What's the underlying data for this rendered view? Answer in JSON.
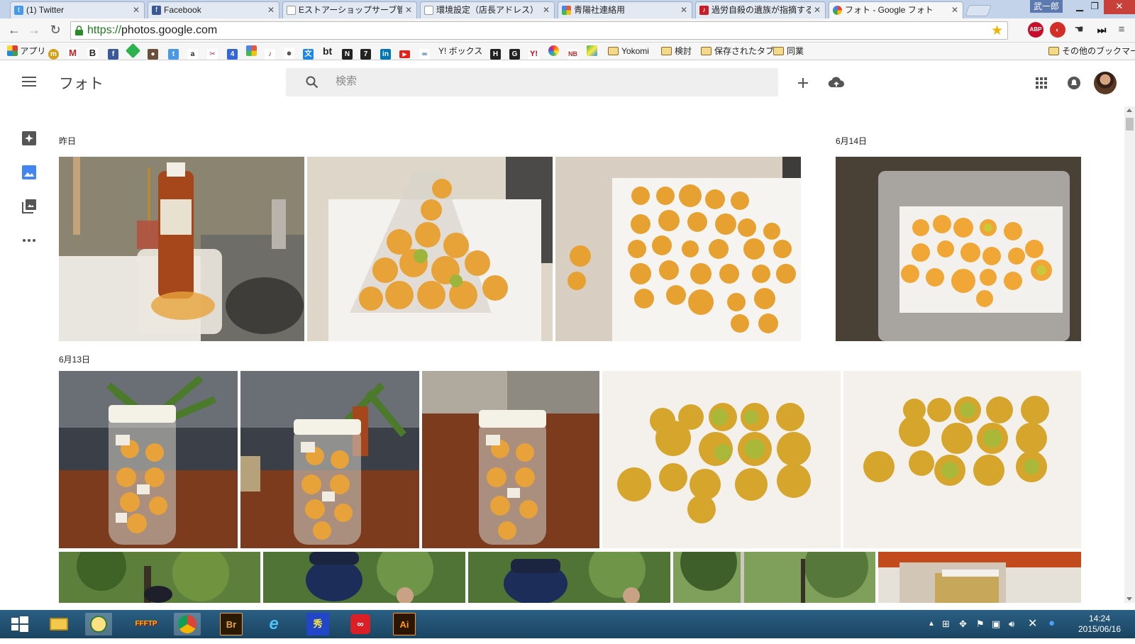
{
  "browser": {
    "tabs": [
      {
        "title": "(1) Twitter",
        "favicon": "twitter-icon",
        "color": "#4a99e9"
      },
      {
        "title": "Facebook",
        "favicon": "facebook-icon",
        "color": "#3b5998"
      },
      {
        "title": "Eストアーショップサーブ管理画",
        "favicon": "page-icon",
        "color": "#ffffff"
      },
      {
        "title": "環境設定（店長アドレス）",
        "favicon": "page-icon",
        "color": "#ffffff"
      },
      {
        "title": "青陽社連絡用",
        "favicon": "pinwheel-icon",
        "color": "#e25a3a"
      },
      {
        "title": "過労自殺の遺族が指摘する「",
        "favicon": "news-icon",
        "color": "#c81d25"
      },
      {
        "title": "フォト - Google フォト",
        "favicon": "google-photos-icon",
        "color": "#fbbc05"
      }
    ],
    "active_tab_index": 6,
    "window_user": "武一郎",
    "url_scheme": "https://",
    "url_host": "photos.google.com",
    "bookmarks": [
      {
        "label": "アプリ",
        "icon": "apps-grid-icon",
        "color": "#d84315"
      },
      {
        "label": "",
        "icon": "mixi-icon",
        "color": "#d4a017"
      },
      {
        "label": "",
        "icon": "gmail-icon",
        "color": "#c5221f"
      },
      {
        "label": "",
        "icon": "blogger-b-icon",
        "color": "#222222"
      },
      {
        "label": "",
        "icon": "facebook-icon",
        "color": "#3b5998"
      },
      {
        "label": "",
        "icon": "feedly-icon",
        "color": "#2bb24c"
      },
      {
        "label": "",
        "icon": "person-icon",
        "color": "#6b4f3a"
      },
      {
        "label": "",
        "icon": "twitter-icon",
        "color": "#4a99e9"
      },
      {
        "label": "",
        "icon": "amazon-icon",
        "color": "#222222"
      },
      {
        "label": "",
        "icon": "tool-icon",
        "color": "#c2185b"
      },
      {
        "label": "",
        "icon": "calendar-icon",
        "color": "#3367d6"
      },
      {
        "label": "",
        "icon": "pinwheel-icon",
        "color": "#e25a3a"
      },
      {
        "label": "",
        "icon": "news-icon",
        "color": "#c81d25"
      },
      {
        "label": "",
        "icon": "apple-icon",
        "color": "#555555"
      },
      {
        "label": "",
        "icon": "translate-icon",
        "color": "#1e88e5"
      },
      {
        "label": "bt",
        "icon": "",
        "color": "#222222"
      },
      {
        "label": "",
        "icon": "notion-icon",
        "color": "#222222"
      },
      {
        "label": "",
        "icon": "seven-icon",
        "color": "#222222"
      },
      {
        "label": "",
        "icon": "linkedin-icon",
        "color": "#0077b5"
      },
      {
        "label": "",
        "icon": "youtube-icon",
        "color": "#e62117"
      },
      {
        "label": "",
        "icon": "ribbon-icon",
        "color": "#1565c0"
      },
      {
        "label": "Y! ボックス",
        "icon": "",
        "color": "#d6001c"
      },
      {
        "label": "",
        "icon": "hatena-icon",
        "color": "#222222"
      },
      {
        "label": "",
        "icon": "g-icon",
        "color": "#222222"
      },
      {
        "label": "",
        "icon": "yahoo-icon",
        "color": "#d6001c"
      },
      {
        "label": "",
        "icon": "colorful-icon",
        "color": "#ff9800"
      },
      {
        "label": "",
        "icon": "nb-icon",
        "color": "#c62828"
      },
      {
        "label": "",
        "icon": "maps-icon",
        "color": "#4caf50"
      },
      {
        "label": "Yokomi",
        "icon": "folder-icon",
        "color": "#f4d98a"
      },
      {
        "label": "検討",
        "icon": "folder-icon",
        "color": "#f4d98a"
      },
      {
        "label": "保存されたタブ",
        "icon": "folder-icon",
        "color": "#f4d98a"
      },
      {
        "label": "同業",
        "icon": "folder-icon",
        "color": "#f4d98a"
      }
    ],
    "other_bookmarks": "その他のブックマーク",
    "extensions": [
      {
        "label": "ABP",
        "icon": "adblock-icon",
        "color": "#c70d2c"
      },
      {
        "label": "",
        "icon": "lastpass-icon",
        "color": "#d32d27"
      },
      {
        "label": "",
        "icon": "hand-icon",
        "color": "#333333"
      },
      {
        "label": "",
        "icon": "fast-forward-icon",
        "color": "#111111"
      },
      {
        "label": "",
        "icon": "chrome-menu-icon",
        "color": "#555555"
      }
    ]
  },
  "app": {
    "title": "フォト",
    "search_placeholder": "検索",
    "sidenav": [
      {
        "name": "assistant-icon"
      },
      {
        "name": "photos-icon"
      },
      {
        "name": "albums-icon"
      },
      {
        "name": "more-icon"
      }
    ]
  },
  "sections": [
    {
      "date": "昨日"
    },
    {
      "date": "6月14日"
    },
    {
      "date": "6月13日"
    }
  ],
  "photos": [
    {
      "subject": "kitchen sink with tea bottle and plum jar",
      "bg": "#8b8470",
      "accent": "#c56a1f"
    },
    {
      "subject": "plastic bag of yellow plums",
      "bg": "#d9d3c6",
      "accent": "#e7a238"
    },
    {
      "subject": "plums on white towel",
      "bg": "#efe9e1",
      "accent": "#e6a131"
    },
    {
      "subject": "plums in clear container on towel",
      "bg": "#50463b",
      "accent": "#f0a736"
    },
    {
      "subject": "glass jar with plums and rock sugar",
      "bg": "#6b3a25",
      "accent": "#e7a23a"
    },
    {
      "subject": "glass jar with plums and rock sugar 2",
      "bg": "#6b3a25",
      "accent": "#e7a23a"
    },
    {
      "subject": "glass jar with plums and rock sugar 3",
      "bg": "#6b3a25",
      "accent": "#e7a23a"
    },
    {
      "subject": "green and yellow plums on towel",
      "bg": "#efeae2",
      "accent": "#c9b437"
    },
    {
      "subject": "green and yellow plums on towel 2",
      "bg": "#efeae2",
      "accent": "#c9b437"
    },
    {
      "subject": "trees in park",
      "bg": "#5c7f3c",
      "accent": "#2f4f1f"
    },
    {
      "subject": "police officer under trees",
      "bg": "#4f7436",
      "accent": "#1d2d5a"
    },
    {
      "subject": "police officer under trees 2",
      "bg": "#4f7436",
      "accent": "#1d2d5a"
    },
    {
      "subject": "park path with trees",
      "bg": "#7ea05a",
      "accent": "#3f5f2a"
    },
    {
      "subject": "package on red surface",
      "bg": "#d7cfc3",
      "accent": "#c24a1d"
    }
  ],
  "taskbar": {
    "apps": [
      {
        "name": "start-button",
        "label": ""
      },
      {
        "name": "file-explorer-icon",
        "label": ""
      },
      {
        "name": "messenger-icon",
        "label": ""
      },
      {
        "name": "ffftp-icon",
        "label": "FFFTP"
      },
      {
        "name": "chrome-icon",
        "label": ""
      },
      {
        "name": "bridge-icon",
        "label": "Br"
      },
      {
        "name": "ie-icon",
        "label": "e"
      },
      {
        "name": "hidemaru-icon",
        "label": "秀"
      },
      {
        "name": "creative-cloud-icon",
        "label": ""
      },
      {
        "name": "illustrator-icon",
        "label": "Ai"
      }
    ],
    "time": "14:24",
    "date": "2015/06/16"
  }
}
